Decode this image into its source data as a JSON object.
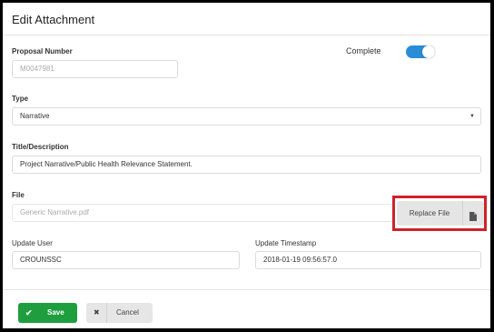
{
  "dialog": {
    "title": "Edit Attachment"
  },
  "form": {
    "proposal_number_label": "Proposal Number",
    "proposal_number_value": "M0047981",
    "complete_label": "Complete",
    "complete_on": true,
    "type_label": "Type",
    "type_value": "Narrative",
    "title_label": "Title/Description",
    "title_value": "Project Narrative/Public Health Relevance Statement.",
    "file_label": "File",
    "file_value": "Generic Narrative.pdf",
    "replace_file_label": "Replace File",
    "update_user_label": "Update User",
    "update_user_value": "CROUNSSC",
    "update_timestamp_label": "Update Timestamp",
    "update_timestamp_value": "2018-01-19 09:56:57.0"
  },
  "footer": {
    "save_label": "Save",
    "cancel_label": "Cancel"
  },
  "icons": {
    "save": "checkmark-icon",
    "cancel": "x-icon",
    "replace": "file-icon",
    "dropdown": "caret-down-icon"
  },
  "colors": {
    "accent_blue": "#2a8bd6",
    "save_green": "#1f9e3f",
    "highlight_red": "#d0212b"
  }
}
